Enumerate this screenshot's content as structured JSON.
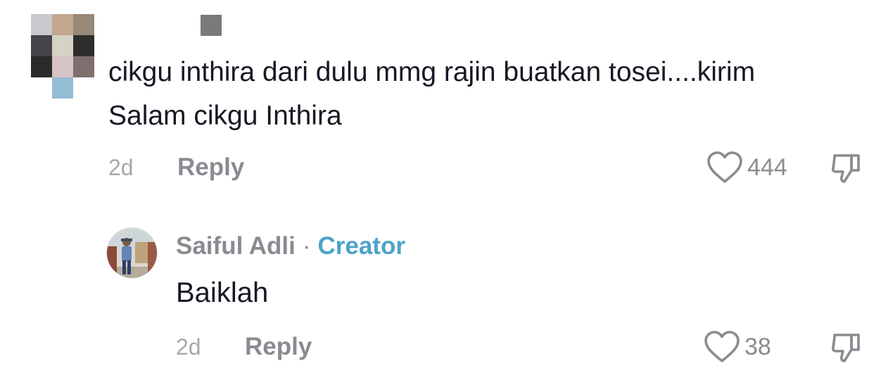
{
  "comment": {
    "text": "cikgu inthira dari dulu mmg rajin buatkan tosei....kirim Salam cikgu Inthira",
    "time": "2d",
    "reply_label": "Reply",
    "likes": "444",
    "like_icon": "heart-outline-icon",
    "dislike_icon": "thumbs-down-icon"
  },
  "reply": {
    "author": "Saiful Adli",
    "separator": "·",
    "badge": "Creator",
    "text": "Baiklah",
    "time": "2d",
    "reply_label": "Reply",
    "likes": "38",
    "like_icon": "heart-outline-icon",
    "dislike_icon": "thumbs-down-icon"
  },
  "colors": {
    "text_primary": "#161823",
    "text_secondary": "#8a8b91",
    "text_tertiary": "#a7a8ad",
    "creator_badge": "#4ba3c7"
  },
  "avatar_mosaic_colors": [
    "#c9c9cd",
    "#c2a68e",
    "#98887a",
    "#45444a",
    "#d5d2c6",
    "#2f2d2c",
    "#2b2b2d",
    "#d6c3c5",
    "#7e706c",
    "#94bcd5",
    "#7a7a7a"
  ]
}
